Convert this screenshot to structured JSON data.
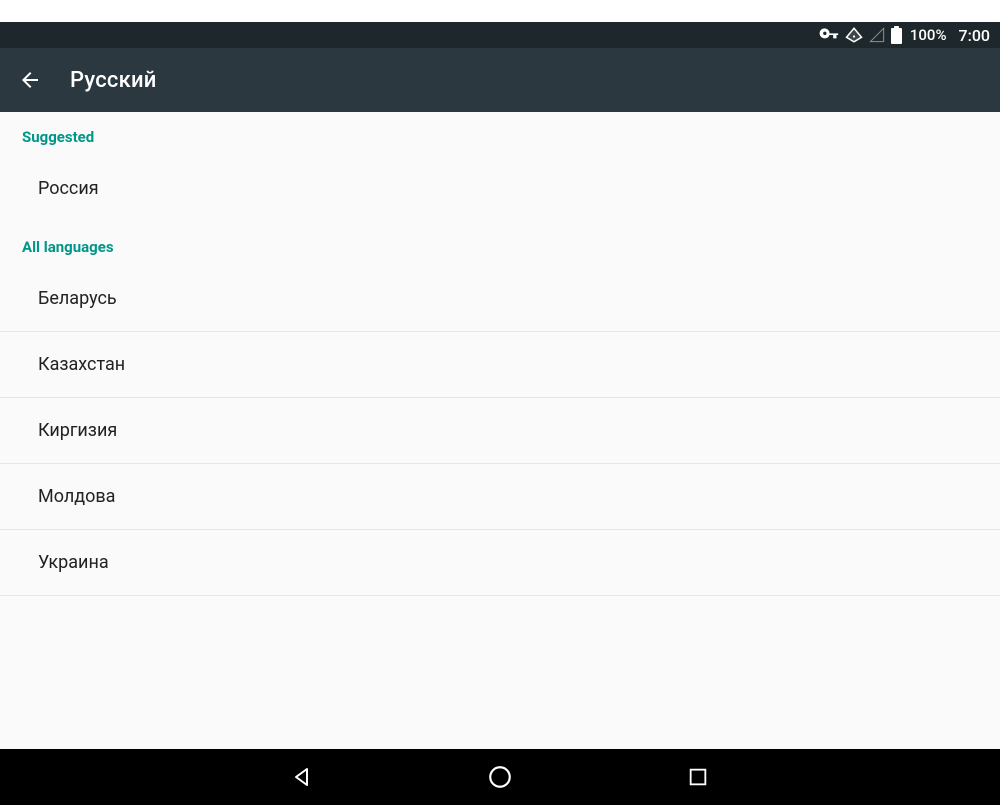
{
  "status": {
    "battery_pct": "100%",
    "time": "7:00"
  },
  "header": {
    "title": "Русский"
  },
  "sections": {
    "suggested_label": "Suggested",
    "all_label": "All languages"
  },
  "suggested_items": [
    {
      "label": "Россия"
    }
  ],
  "all_items": [
    {
      "label": "Беларусь"
    },
    {
      "label": "Казахстан"
    },
    {
      "label": "Киргизия"
    },
    {
      "label": "Молдова"
    },
    {
      "label": "Украина"
    }
  ]
}
